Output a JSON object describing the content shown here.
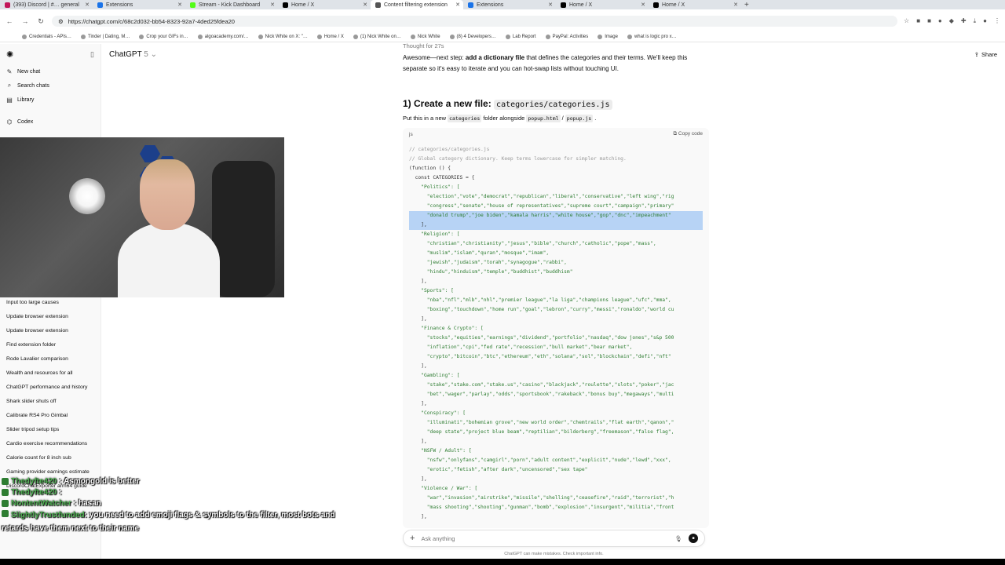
{
  "tabs": [
    {
      "label": "(393) Discord | #… general",
      "color": "#c2185b"
    },
    {
      "label": "Extensions",
      "color": "#1a73e8"
    },
    {
      "label": "Stream - Kick Dashboard",
      "color": "#53fc18"
    },
    {
      "label": "Home / X",
      "color": "#000000"
    },
    {
      "label": "Content filtering extension",
      "color": "#555555",
      "active": true
    },
    {
      "label": "Extensions",
      "color": "#1a73e8"
    },
    {
      "label": "Home / X",
      "color": "#000000"
    },
    {
      "label": "Home / X",
      "color": "#000000"
    }
  ],
  "toolbar": {
    "url": "https://chatgpt.com/c/68c2d032-bb54-8323-92a7-4ded25fdea20"
  },
  "bookmarks": [
    "Credentials - APIs…",
    "Tinder | Dating, M…",
    "Crop your GIFs in…",
    "algoacademy.com/…",
    "Nick White on X: \"…",
    "Home / X",
    "(1) Nick White on…",
    "Nick White",
    "(8) 4 Developers…",
    "Lab Report",
    "PayPal: Activities",
    "Image",
    "what is logic pro x…"
  ],
  "sidebar": {
    "top_items": [
      {
        "label": "New chat",
        "icon": "pencil-icon"
      },
      {
        "label": "Search chats",
        "icon": "search-icon"
      },
      {
        "label": "Library",
        "icon": "library-icon"
      },
      {
        "label": "Codex",
        "icon": "codex-icon"
      }
    ],
    "chats": [
      "Input too large causes",
      "Update browser extension",
      "Update browser extension",
      "Find extension folder",
      "Rode Lavalier comparison",
      "Wealth and resources for all",
      "ChatGPT performance and history",
      "Shark slider shuts off",
      "Calibrate RS4 Pro Gimbal",
      "Slider tripod setup tips",
      "Cardio exercise recommendations",
      "Calorie count for 8 inch sub",
      "Gaming provider earnings estimate",
      "DiscordChatExporter arm64 guide"
    ]
  },
  "header": {
    "model": "ChatGPT",
    "version": "5",
    "share": "Share"
  },
  "message": {
    "thought": "Thought for 27s",
    "intro_pre": "Awesome—next step: ",
    "intro_bold": "add a dictionary file",
    "intro_post": " that defines the categories and their terms. We'll keep this separate so it's easy to iterate and you can hot-swap lists without touching UI.",
    "heading_pre": "1) Create a new file: ",
    "heading_code": "categories/categories.js",
    "put_pre": "Put this in a new ",
    "put_code1": "categories",
    "put_mid": " folder alongside ",
    "put_code2": "popup.html",
    "put_sep": " / ",
    "put_code3": "popup.js",
    "put_end": " ."
  },
  "code": {
    "lang": "js",
    "copy": "Copy code",
    "lines": [
      {
        "t": "// categories/categories.js",
        "c": "cm"
      },
      {
        "t": "// Global category dictionary. Keep terms lowercase for simpler matching.",
        "c": "cm"
      },
      {
        "t": "(function () {",
        "c": ""
      },
      {
        "t": "  const CATEGORIES = {",
        "c": ""
      },
      {
        "t": "    \"Politics\": [",
        "c": "st"
      },
      {
        "t": "      \"election\",\"vote\",\"democrat\",\"republican\",\"liberal\",\"conservative\",\"left wing\",\"rig",
        "c": "st"
      },
      {
        "t": "      \"congress\",\"senate\",\"house of representatives\",\"supreme court\",\"campaign\",\"primary\"",
        "c": "st"
      },
      {
        "t": "      \"donald trump\",\"joe biden\",\"kamala harris\",\"white house\",\"gop\",\"dnc\",\"impeachment\"",
        "c": "st hl"
      },
      {
        "t": "    ],",
        "c": "hl"
      },
      {
        "t": "    \"Religion\": [",
        "c": "st"
      },
      {
        "t": "      \"christian\",\"christianity\",\"jesus\",\"bible\",\"church\",\"catholic\",\"pope\",\"mass\",",
        "c": "st"
      },
      {
        "t": "      \"muslim\",\"islam\",\"quran\",\"mosque\",\"imam\",",
        "c": "st"
      },
      {
        "t": "      \"jewish\",\"judaism\",\"torah\",\"synagogue\",\"rabbi\",",
        "c": "st"
      },
      {
        "t": "      \"hindu\",\"hinduism\",\"temple\",\"buddhist\",\"buddhism\"",
        "c": "st"
      },
      {
        "t": "    ],",
        "c": ""
      },
      {
        "t": "    \"Sports\": [",
        "c": "st"
      },
      {
        "t": "      \"nba\",\"nfl\",\"mlb\",\"nhl\",\"premier league\",\"la liga\",\"champions league\",\"ufc\",\"mma\",",
        "c": "st"
      },
      {
        "t": "      \"boxing\",\"touchdown\",\"home run\",\"goal\",\"lebron\",\"curry\",\"messi\",\"ronaldo\",\"world cu",
        "c": "st"
      },
      {
        "t": "    ],",
        "c": ""
      },
      {
        "t": "    \"Finance & Crypto\": [",
        "c": "st"
      },
      {
        "t": "      \"stocks\",\"equities\",\"earnings\",\"dividend\",\"portfolio\",\"nasdaq\",\"dow jones\",\"s&p 500",
        "c": "st"
      },
      {
        "t": "      \"inflation\",\"cpi\",\"fed rate\",\"recession\",\"bull market\",\"bear market\",",
        "c": "st"
      },
      {
        "t": "      \"crypto\",\"bitcoin\",\"btc\",\"ethereum\",\"eth\",\"solana\",\"sol\",\"blockchain\",\"defi\",\"nft\"",
        "c": "st"
      },
      {
        "t": "    ],",
        "c": ""
      },
      {
        "t": "    \"Gambling\": [",
        "c": "st"
      },
      {
        "t": "      \"stake\",\"stake.com\",\"stake.us\",\"casino\",\"blackjack\",\"roulette\",\"slots\",\"poker\",\"jac",
        "c": "st"
      },
      {
        "t": "      \"bet\",\"wager\",\"parlay\",\"odds\",\"sportsbook\",\"rakeback\",\"bonus buy\",\"megaways\",\"multi",
        "c": "st"
      },
      {
        "t": "    ],",
        "c": ""
      },
      {
        "t": "    \"Conspiracy\": [",
        "c": "st"
      },
      {
        "t": "      \"illuminati\",\"bohemian grove\",\"new world order\",\"chemtrails\",\"flat earth\",\"qanon\",\"",
        "c": "st"
      },
      {
        "t": "      \"deep state\",\"project blue beam\",\"reptilian\",\"bilderberg\",\"freemason\",\"false flag\",",
        "c": "st"
      },
      {
        "t": "    ],",
        "c": ""
      },
      {
        "t": "    \"NSFW / Adult\": [",
        "c": "st"
      },
      {
        "t": "      \"nsfw\",\"onlyfans\",\"camgirl\",\"porn\",\"adult content\",\"explicit\",\"nude\",\"lewd\",\"xxx\",",
        "c": "st"
      },
      {
        "t": "      \"erotic\",\"fetish\",\"after dark\",\"uncensored\",\"sex tape\"",
        "c": "st"
      },
      {
        "t": "    ],",
        "c": ""
      },
      {
        "t": "    \"Violence / War\": [",
        "c": "st"
      },
      {
        "t": "      \"war\",\"invasion\",\"airstrike\",\"missile\",\"shelling\",\"ceasefire\",\"raid\",\"terrorist\",\"h",
        "c": "st"
      },
      {
        "t": "      \"mass shooting\",\"shooting\",\"gunman\",\"bomb\",\"explosion\",\"insurgent\",\"militia\",\"front",
        "c": "st"
      },
      {
        "t": "    ],",
        "c": ""
      }
    ]
  },
  "composer": {
    "placeholder": "Ask anything",
    "disclaimer": "ChatGPT can make mistakes. Check important info."
  },
  "stream_chat": [
    {
      "user": "Thedyfte420",
      "text": ": Asmongold is better"
    },
    {
      "user": "Thedyfte420",
      "text": ":"
    },
    {
      "user": "NontentWatcher",
      "text": ": hasan"
    },
    {
      "user": "SlightlyTrustfunded",
      "text": ": you need to add emoji flags & symbols to the filter, most bots and retards have them next to their name"
    }
  ]
}
